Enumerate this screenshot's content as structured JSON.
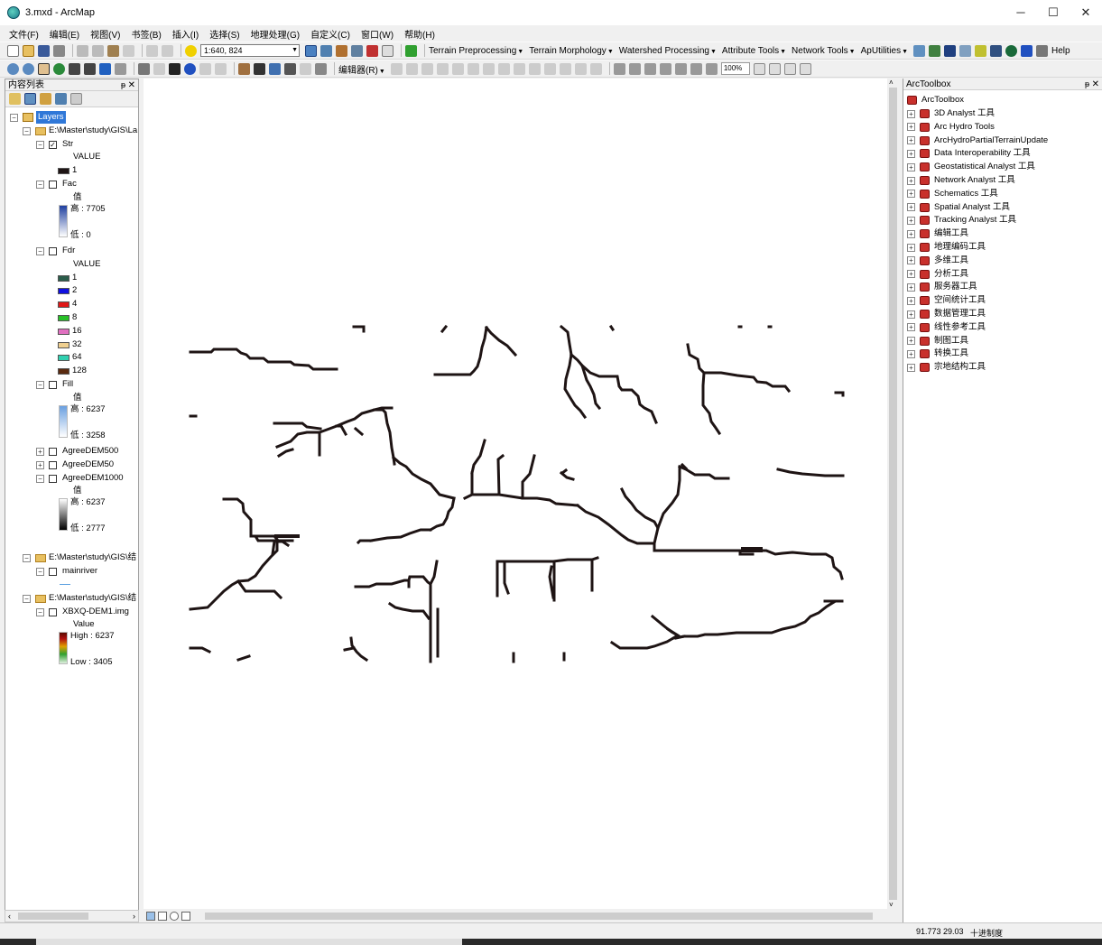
{
  "window": {
    "title": "3.mxd - ArcMap",
    "controls": {
      "minimize": "─",
      "maximize": "☐",
      "close": "✕"
    }
  },
  "menubar": [
    "文件(F)",
    "编辑(E)",
    "视图(V)",
    "书签(B)",
    "插入(I)",
    "选择(S)",
    "地理处理(G)",
    "自定义(C)",
    "窗口(W)",
    "帮助(H)"
  ],
  "toolbar1": {
    "scale": "1:640, 824",
    "menus": [
      "Terrain Preprocessing",
      "Terrain Morphology",
      "Watershed Processing",
      "Attribute Tools",
      "Network Tools",
      "ApUtilities"
    ],
    "help": "Help"
  },
  "toolbar2": {
    "editor_label": "编辑器(R)",
    "zoom_percent": "100%"
  },
  "toc": {
    "title": "内容列表",
    "root": "Layers",
    "group1_path": "E:\\Master\\study\\GIS\\La",
    "layers": [
      {
        "name": "Str",
        "checked": true,
        "field": "VALUE",
        "classes": [
          {
            "label": "1",
            "color": "#1e1414"
          }
        ]
      },
      {
        "name": "Fac",
        "checked": false,
        "field": "值",
        "high": "高 : 7705",
        "low": "低 : 0"
      },
      {
        "name": "Fdr",
        "checked": false,
        "field": "VALUE",
        "classes": [
          {
            "label": "1",
            "color": "#2a5c4a"
          },
          {
            "label": "2",
            "color": "#1010e0"
          },
          {
            "label": "4",
            "color": "#e01818"
          },
          {
            "label": "8",
            "color": "#28c028"
          },
          {
            "label": "16",
            "color": "#e070c0"
          },
          {
            "label": "32",
            "color": "#f0d090"
          },
          {
            "label": "64",
            "color": "#30d0b0"
          },
          {
            "label": "128",
            "color": "#5a2a10"
          }
        ]
      },
      {
        "name": "Fill",
        "checked": false,
        "field": "值",
        "high": "高 : 6237",
        "low": "低 : 3258"
      },
      {
        "name": "AgreeDEM500",
        "checked": false
      },
      {
        "name": "AgreeDEM50",
        "checked": false
      },
      {
        "name": "AgreeDEM1000",
        "checked": false,
        "field": "值",
        "high": "高 : 6237",
        "low": "低 : 2777"
      }
    ],
    "group2_path": "E:\\Master\\study\\GIS\\结",
    "group2_layer": "mainriver",
    "group3_path": "E:\\Master\\study\\GIS\\结",
    "group3_layer": "XBXQ-DEM1.img",
    "group3_field": "Value",
    "group3_high": "High : 6237",
    "group3_low": "Low : 3405"
  },
  "toolbox": {
    "title": "ArcToolbox",
    "root": "ArcToolbox",
    "items": [
      "3D Analyst 工具",
      "Arc Hydro Tools",
      "ArcHydroPartialTerrainUpdate",
      "Data Interoperability 工具",
      "Geostatistical Analyst 工具",
      "Network Analyst 工具",
      "Schematics 工具",
      "Spatial Analyst 工具",
      "Tracking Analyst 工具",
      "编辑工具",
      "地理编码工具",
      "多维工具",
      "分析工具",
      "服务器工具",
      "空间统计工具",
      "数据管理工具",
      "线性参考工具",
      "制图工具",
      "转换工具",
      "宗地结构工具"
    ]
  },
  "statusbar": {
    "coords": "91.773  29.03",
    "units": "十进制度"
  },
  "map": {
    "stream_color": "#1e1414"
  }
}
